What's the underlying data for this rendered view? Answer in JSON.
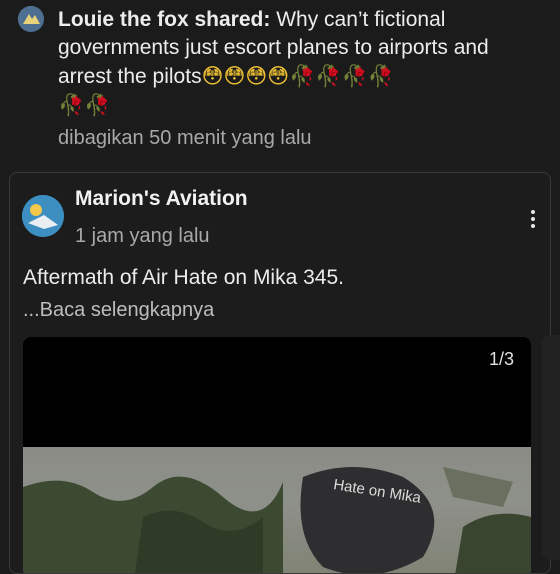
{
  "share": {
    "who": "Louie the fox shared:",
    "text": " Why can’t fictional governments just escort planes to airports and arrest the pilots",
    "flushed": "😳😳😳😳",
    "roses_line1": "🥀🥀🥀🥀",
    "roses_line2": "🥀🥀",
    "time": "dibagikan 50 menit yang lalu"
  },
  "post": {
    "author": "Marion's Aviation",
    "time": "1 jam yang lalu",
    "text": "Aftermath of Air Hate on Mika 345.",
    "read_more": "...Baca selengkapnya",
    "media_counter": "1/3",
    "photo_overlay": "Hate on Mika"
  },
  "icons": {
    "share_avatar": "avatar-icon",
    "post_avatar": "avatar-icon",
    "more": "more-vertical-icon"
  }
}
